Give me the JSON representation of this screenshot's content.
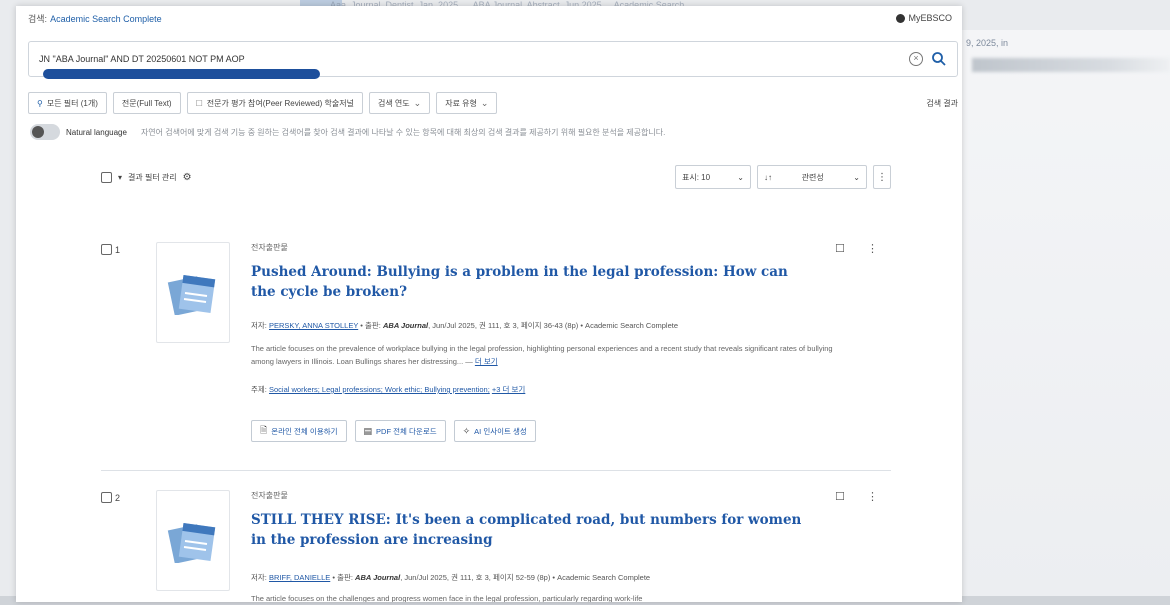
{
  "header": {
    "db_prefix": "검색:",
    "db_name": "Academic Search Complete",
    "myebsco": "MyEBSCO"
  },
  "search": {
    "query": "JN \"ABA Journal\" AND DT 20250601 NOT PM AOP"
  },
  "filters": {
    "all_filters": "모든 필터 (1개)",
    "full_text": "전문(Full Text)",
    "peer_reviewed": "전문가 평가 참여(Peer Reviewed) 학술저널",
    "date": "검색 연도",
    "source_type": "자료 유형",
    "right_label": "검색 결과"
  },
  "natural_language": {
    "label": "Natural language",
    "hint": "자연어 검색어에 맞게 검색 기능 중 원하는 검색어를 찾아 검색 결과에 나타날 수 있는 항목에 대해 최상의 검색 결과를 제공하기 위해 필요한 분석을 제공합니다."
  },
  "results_bar": {
    "select_all": "결과 필터 관리",
    "page_size": "표시: 10",
    "sort": "관련성"
  },
  "results": [
    {
      "index": "1",
      "publication_type": "전자출판물",
      "title": "Pushed Around: Bullying is a problem in the legal profession: How can the cycle be broken?",
      "meta_prefix": "저자:",
      "author": "PERSKY, ANNA STOLLEY",
      "source_prefix": "• 출판:",
      "journal": "ABA Journal",
      "meta_rest": ", Jun/Jul 2025, 권 111, 호 3, 페이지 36-43 (8p) • Academic Search Complete",
      "abstract": "The article focuses on the prevalence of workplace bullying in the legal profession, highlighting personal experiences and a recent study that reveals significant rates of bullying among lawyers in Illinois. Loan Bullings shares her distressing... —",
      "abstract_more": "더 보기",
      "subjects_prefix": "주제:",
      "subjects": "Social workers; Legal professions; Work ethic; Bullying prevention;",
      "subjects_more": "+3 더 보기",
      "actions": [
        "온라인 전체 이용하기",
        "PDF 전체 다운로드",
        "AI 인사이트 생성"
      ]
    },
    {
      "index": "2",
      "publication_type": "전자출판물",
      "title": "STILL THEY RISE: It's been a complicated road, but numbers for women in the profession are increasing",
      "meta_prefix": "저자:",
      "author": "BRIFF, DANIELLE",
      "source_prefix": "• 출판:",
      "journal": "ABA Journal",
      "meta_rest": ", Jun/Jul 2025, 권 111, 호 3, 페이지 52-59 (8p) • Academic Search Complete",
      "abstract": "The article focuses on the challenges and progress women face in the legal profession, particularly regarding work-life"
    }
  ],
  "background": {
    "strip": "Aaa. Journal. Dentist. Jan. 2025. ... ABA Journal. Abstract. Jun 2025 ... Academic Search",
    "side_text": "9, 2025, in"
  },
  "colors": {
    "link": "#2058a6",
    "highlight_underline": "#1d4f9c"
  }
}
